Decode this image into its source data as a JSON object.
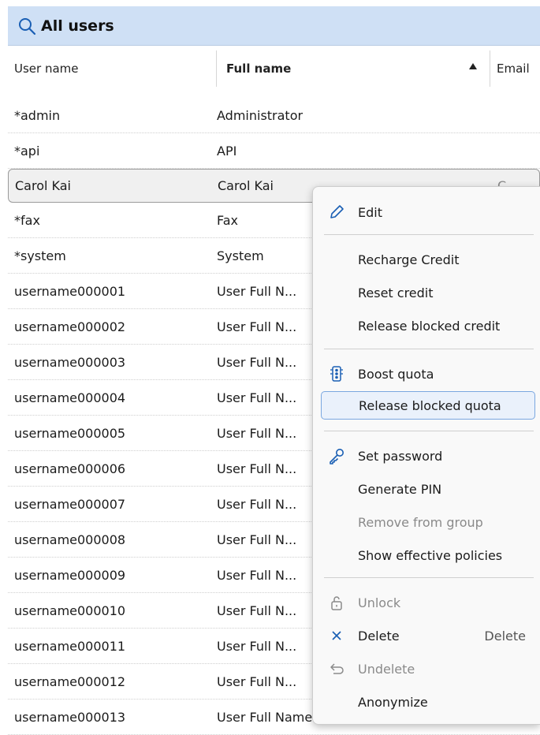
{
  "header": {
    "title": "All users"
  },
  "columns": {
    "user_name": "User name",
    "full_name": "Full name",
    "email": "Email"
  },
  "rows": [
    {
      "user": "*admin",
      "full": "Administrator"
    },
    {
      "user": "*api",
      "full": "API"
    },
    {
      "user": "Carol Kai",
      "full": "Carol Kai",
      "email": "C...",
      "selected": true
    },
    {
      "user": "*fax",
      "full": "Fax"
    },
    {
      "user": "*system",
      "full": "System"
    },
    {
      "user": "username000001",
      "full": "User Full N..."
    },
    {
      "user": "username000002",
      "full": "User Full N..."
    },
    {
      "user": "username000003",
      "full": "User Full N..."
    },
    {
      "user": "username000004",
      "full": "User Full N..."
    },
    {
      "user": "username000005",
      "full": "User Full N..."
    },
    {
      "user": "username000006",
      "full": "User Full N..."
    },
    {
      "user": "username000007",
      "full": "User Full N..."
    },
    {
      "user": "username000008",
      "full": "User Full N..."
    },
    {
      "user": "username000009",
      "full": "User Full N..."
    },
    {
      "user": "username000010",
      "full": "User Full N..."
    },
    {
      "user": "username000011",
      "full": "User Full N..."
    },
    {
      "user": "username000012",
      "full": "User Full N..."
    },
    {
      "user": "username000013",
      "full": "User Full Name"
    }
  ],
  "menu": {
    "edit": "Edit",
    "recharge_credit": "Recharge Credit",
    "reset_credit": "Reset credit",
    "release_blocked_credit": "Release blocked credit",
    "boost_quota": "Boost quota",
    "release_blocked_quota": "Release blocked quota",
    "set_password": "Set password",
    "generate_pin": "Generate PIN",
    "remove_from_group": "Remove from group",
    "show_effective_policies": "Show effective policies",
    "unlock": "Unlock",
    "delete": "Delete",
    "delete_shortcut": "Delete",
    "undelete": "Undelete",
    "anonymize": "Anonymize"
  },
  "icons": {
    "search": "search-icon",
    "sort": "sort-ascending-icon",
    "edit": "pencil-icon",
    "boost": "traffic-light-icon",
    "password": "key-icon",
    "unlock": "unlock-icon",
    "delete": "close-icon",
    "undelete": "undo-icon"
  },
  "colors": {
    "accent": "#1a5fb4",
    "header_bg": "#cfe0f5",
    "hover_border": "#7aa7e0"
  }
}
